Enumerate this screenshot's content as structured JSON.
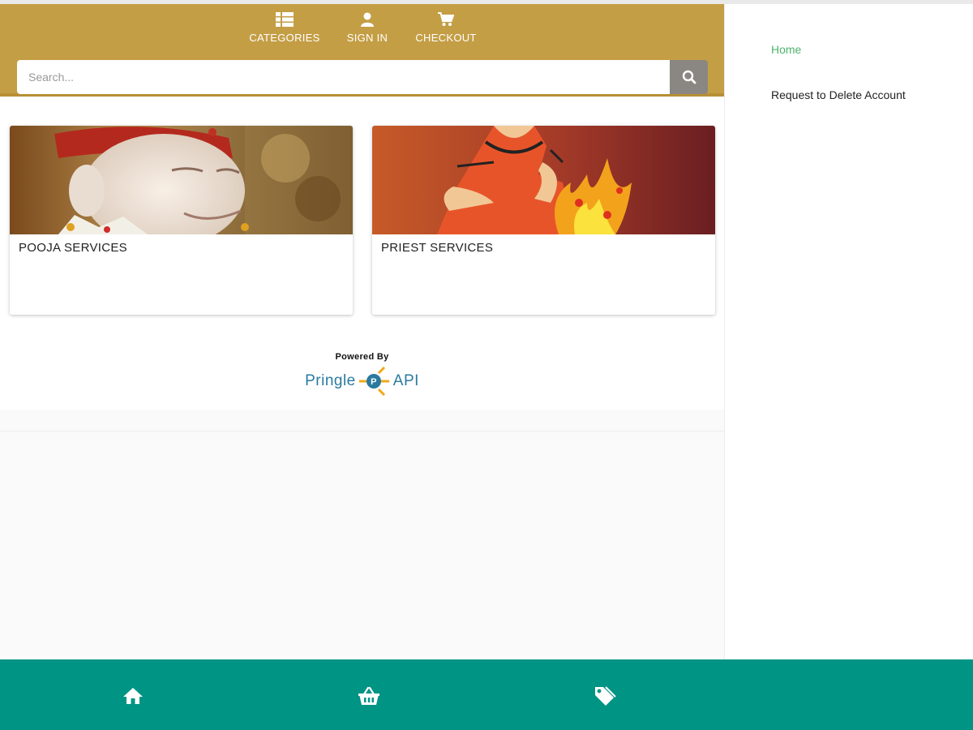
{
  "nav": {
    "categories_label": "CATEGORIES",
    "signin_label": "SIGN IN",
    "checkout_label": "CHECKOUT"
  },
  "search": {
    "placeholder": "Search...",
    "value": ""
  },
  "cards": [
    {
      "title": "POOJA SERVICES",
      "image": "sai-baba-idol"
    },
    {
      "title": "PRIEST SERVICES",
      "image": "priest-at-fire-ritual"
    }
  ],
  "footer": {
    "powered_by": "Powered By",
    "brand_left": "Pringle",
    "brand_right": "API",
    "logo_letter": "P"
  },
  "sidebar": {
    "home": "Home",
    "delete_account": "Request to Delete Account"
  },
  "bottom_tabs": [
    {
      "icon": "home-icon"
    },
    {
      "icon": "basket-icon"
    },
    {
      "icon": "tag-icon"
    }
  ],
  "colors": {
    "header": "#c49e45",
    "bottom_bar": "#009485",
    "home_link": "#4db36a",
    "search_button": "#8a8782",
    "brand": "#2a7aa0",
    "logo_accent": "#f0a818"
  }
}
